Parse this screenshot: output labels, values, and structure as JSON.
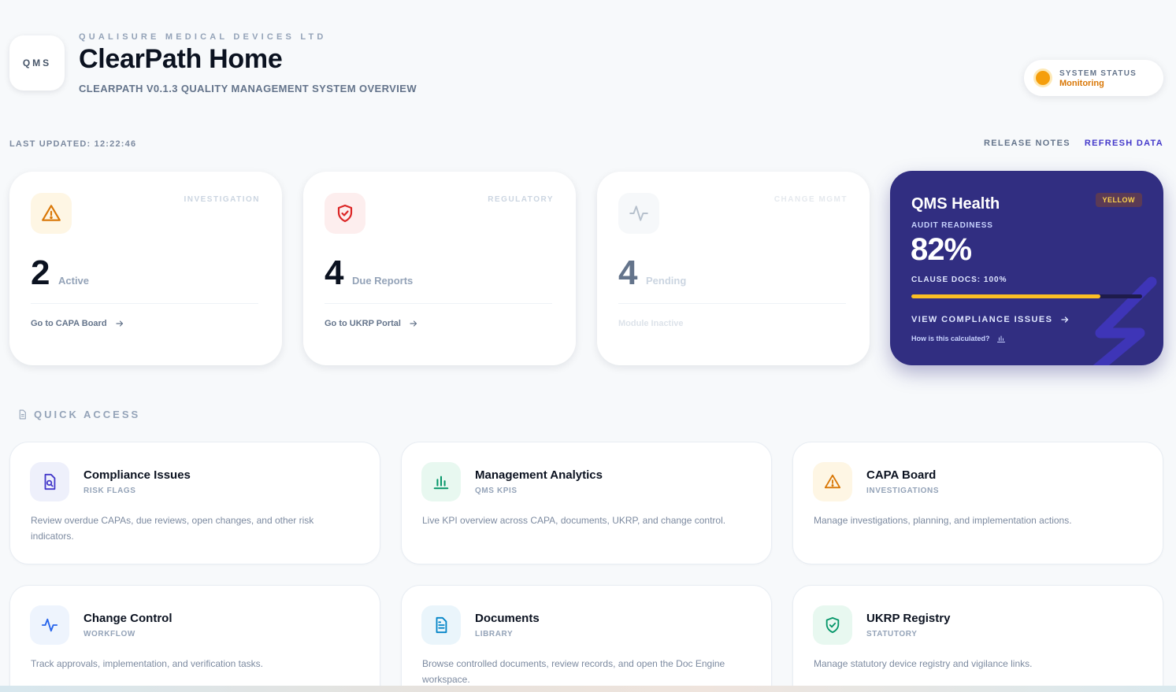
{
  "header": {
    "logo_text": "QMS",
    "company": "QUALISURE MEDICAL DEVICES LTD",
    "title": "ClearPath Home",
    "subtitle": "CLEARPATH V0.1.3 QUALITY MANAGEMENT SYSTEM OVERVIEW"
  },
  "system_status": {
    "label": "SYSTEM STATUS",
    "value": "Monitoring",
    "color": "#f59e0b"
  },
  "toolbar": {
    "last_updated": "LAST UPDATED: 12:22:46",
    "release_notes": "RELEASE NOTES",
    "refresh": "REFRESH DATA"
  },
  "stats": [
    {
      "tag": "INVESTIGATION",
      "value": "2",
      "label": "Active",
      "link": "Go to CAPA Board",
      "icon": "warning-icon",
      "accent": "#d97706"
    },
    {
      "tag": "REGULATORY",
      "value": "4",
      "label": "Due Reports",
      "link": "Go to UKRP Portal",
      "icon": "shield-icon",
      "accent": "#dc2626"
    },
    {
      "tag": "CHANGE MGMT",
      "value": "4",
      "label": "Pending",
      "link": "Module Inactive",
      "icon": "activity-icon",
      "accent": "#cbd5e1"
    }
  ],
  "health": {
    "title": "QMS Health",
    "badge": "YELLOW",
    "sub": "AUDIT READINESS",
    "percent": "82%",
    "clause": "CLAUSE DOCS: 100%",
    "progress": 0.82,
    "link": "VIEW COMPLIANCE ISSUES",
    "help": "How is this calculated?",
    "color": "#312e81"
  },
  "quick_access": {
    "title": "QUICK ACCESS",
    "items": [
      {
        "title": "Compliance Issues",
        "sub": "RISK FLAGS",
        "desc": "Review overdue CAPAs, due reviews, open changes, and other risk indicators.",
        "icon": "document-search-icon"
      },
      {
        "title": "Management Analytics",
        "sub": "QMS KPIS",
        "desc": "Live KPI overview across CAPA, documents, UKRP, and change control.",
        "icon": "bar-chart-icon"
      },
      {
        "title": "CAPA Board",
        "sub": "INVESTIGATIONS",
        "desc": "Manage investigations, planning, and implementation actions.",
        "icon": "warning-icon"
      },
      {
        "title": "Change Control",
        "sub": "WORKFLOW",
        "desc": "Track approvals, implementation, and verification tasks.",
        "icon": "activity-icon"
      },
      {
        "title": "Documents",
        "sub": "LIBRARY",
        "desc": "Browse controlled documents, review records, and open the Doc Engine workspace.",
        "icon": "document-icon"
      },
      {
        "title": "UKRP Registry",
        "sub": "STATUTORY",
        "desc": "Manage statutory device registry and vigilance links.",
        "icon": "shield-check-icon"
      }
    ]
  }
}
